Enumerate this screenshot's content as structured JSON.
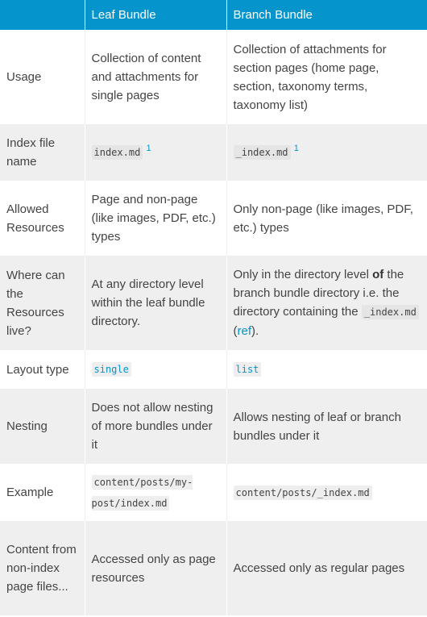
{
  "table": {
    "headers": [
      "",
      "Leaf Bundle",
      "Branch Bundle"
    ],
    "rows": {
      "usage": {
        "label": "Usage",
        "leaf": "Collection of content and attachments for single pages",
        "branch": "Collection of attachments for section pages (home page, section, taxonomy terms, taxonomy list)"
      },
      "index_file": {
        "label": "Index file name",
        "leaf_code": "index.md",
        "leaf_sup": "1",
        "branch_code": "_index.md",
        "branch_sup": "1"
      },
      "allowed_resources": {
        "label": "Allowed Resources",
        "leaf": "Page and non-page (like images, PDF, etc.) types",
        "branch": "Only non-page (like images, PDF, etc.) types"
      },
      "resources_live": {
        "label": "Where can the Resources live?",
        "leaf": "At any directory level within the leaf bundle directory.",
        "branch_pre": "Only in the directory level ",
        "branch_bold": "of",
        "branch_mid": " the branch bundle directory i.e. the directory containing the ",
        "branch_code": "_index.md",
        "branch_paren_open": " (",
        "branch_link": "ref",
        "branch_paren_close": ")."
      },
      "layout_type": {
        "label": "Layout type",
        "leaf_code": "single",
        "branch_code": "list"
      },
      "nesting": {
        "label": "Nesting",
        "leaf": "Does not allow nesting of more bundles under it",
        "branch": "Allows nesting of leaf or branch bundles under it"
      },
      "example": {
        "label": "Example",
        "leaf_code": "content/posts/my-post/index.md",
        "branch_code": "content/posts/_index.md"
      },
      "content_non_index": {
        "label": "Content from non-index page files...",
        "leaf": "Accessed only as page resources",
        "branch": "Accessed only as regular pages"
      }
    }
  },
  "colors": {
    "header_bg": "#0594cb",
    "link": "#0594cb",
    "row_alt": "#efefef"
  }
}
